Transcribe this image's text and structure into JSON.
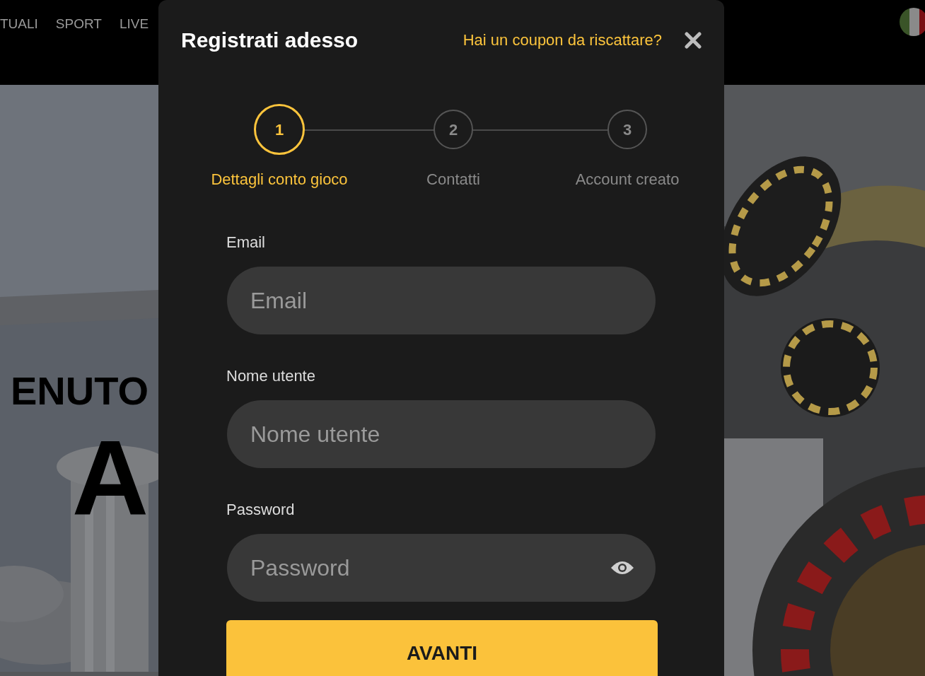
{
  "header": {
    "nav": [
      {
        "label": "TUALI"
      },
      {
        "label": "SPORT"
      },
      {
        "label": "LIVE"
      }
    ]
  },
  "hero": {
    "lines": [
      "ENUTO",
      "A"
    ]
  },
  "modal": {
    "title": "Registrati adesso",
    "coupon_link": "Hai un coupon da riscattare?",
    "steps": [
      {
        "number": "1",
        "label": "Dettagli conto gioco",
        "selected": true
      },
      {
        "number": "2",
        "label": "Contatti",
        "selected": false
      },
      {
        "number": "3",
        "label": "Account creato",
        "selected": false
      }
    ],
    "fields": [
      {
        "label": "Email",
        "placeholder": "Email",
        "kind": "text"
      },
      {
        "label": "Nome utente",
        "placeholder": "Nome utente",
        "kind": "text"
      },
      {
        "label": "Password",
        "placeholder": "Password",
        "kind": "password"
      }
    ],
    "submit": "AVANTI"
  }
}
